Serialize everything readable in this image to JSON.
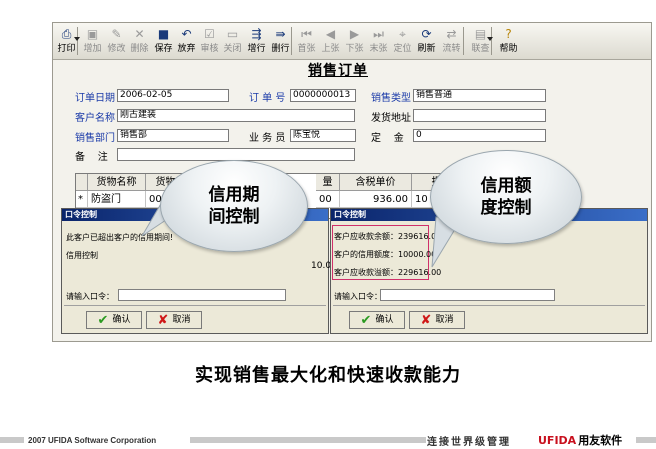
{
  "toolbar": {
    "buttons": [
      {
        "label": "打印",
        "icon": "printer-icon",
        "enabled": true
      },
      {
        "label": "增加",
        "icon": "add-document-icon",
        "enabled": false
      },
      {
        "label": "修改",
        "icon": "edit-icon",
        "enabled": false
      },
      {
        "label": "删除",
        "icon": "delete-x-icon",
        "enabled": false
      },
      {
        "label": "保存",
        "icon": "save-disk-icon",
        "enabled": true
      },
      {
        "label": "放弃",
        "icon": "undo-icon",
        "enabled": true
      },
      {
        "label": "审核",
        "icon": "audit-icon",
        "enabled": false
      },
      {
        "label": "关闭",
        "icon": "close-folder-icon",
        "enabled": false
      },
      {
        "label": "增行",
        "icon": "add-row-icon",
        "enabled": true
      },
      {
        "label": "删行",
        "icon": "delete-row-icon",
        "enabled": true
      },
      {
        "label": "首张",
        "icon": "first-record-icon",
        "enabled": false
      },
      {
        "label": "上张",
        "icon": "prev-record-icon",
        "enabled": false
      },
      {
        "label": "下张",
        "icon": "next-record-icon",
        "enabled": false
      },
      {
        "label": "末张",
        "icon": "last-record-icon",
        "enabled": false
      },
      {
        "label": "定位",
        "icon": "locate-icon",
        "enabled": false
      },
      {
        "label": "刷新",
        "icon": "refresh-icon",
        "enabled": true
      },
      {
        "label": "流转",
        "icon": "flow-icon",
        "enabled": false
      },
      {
        "label": "联查",
        "icon": "query-icon",
        "enabled": false
      },
      {
        "label": "帮助",
        "icon": "help-icon",
        "enabled": true
      }
    ]
  },
  "form": {
    "title": "销售订单",
    "order_date_label": "订单日期",
    "order_date": "2006-02-05",
    "order_no_label": "订 单 号",
    "order_no": "0000000013",
    "sales_type_label": "销售类型",
    "sales_type": "销售普通",
    "customer_label": "客户名称",
    "customer": "刚古建装",
    "ship_addr_label": "发货地址",
    "ship_addr": "",
    "dept_label": "销售部门",
    "dept": "销售部",
    "salesman_label": "业 务 员",
    "salesman": "陈宝悦",
    "deposit_label": "定    金",
    "deposit": "0",
    "remark_label": "备    注",
    "remark": ""
  },
  "grid": {
    "headers": [
      "货物名称",
      "货物编",
      "量",
      "含税单价",
      "报价"
    ],
    "row": {
      "marker": "*",
      "name": "防盗门",
      "code": "001",
      "qty": "00",
      "price": "936.00",
      "quote": "10"
    }
  },
  "dialog_left": {
    "title": "口令控制",
    "message": "此客户已超出客户的信用期间!",
    "sub": "信用控制",
    "prompt": "请输入口令：",
    "ok": "确认",
    "cancel": "取消"
  },
  "dialog_right": {
    "title": "口令控制",
    "line1": "客户应收款余额：239616.00",
    "line2": "客户的信用额度：10000.00",
    "line3": "客户应收款溢额：229616.00",
    "prompt": "请输入口令：",
    "ok": "确认",
    "cancel": "取消",
    "partial_value": "10.0"
  },
  "callouts": {
    "left": "信用期\n间控制",
    "right": "信用额\n度控制"
  },
  "caption": "实现销售最大化和快速收款能力",
  "footer": {
    "copyright": "2007 UFIDA Software Corporation",
    "slogan": "连接世界级管理",
    "brand": "UFIDA",
    "brand_cn": "用友软件"
  },
  "colors": {
    "label_blue": "#1a3aa8",
    "dialog_title": "#0a246a",
    "brand_red": "#c8101e",
    "info_border": "#d0306a"
  }
}
